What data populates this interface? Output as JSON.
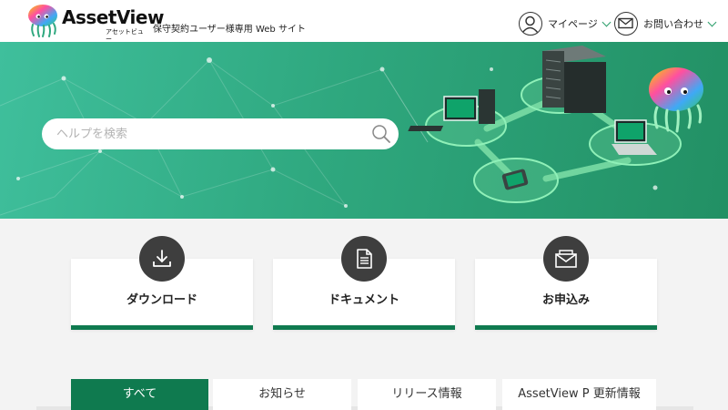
{
  "header": {
    "logo_text": "AssetView",
    "logo_sub": "アセットビュー",
    "site_caption": "保守契約ユーザー様専用 Web サイト",
    "mypage_label": "マイページ",
    "contact_label": "お問い合わせ"
  },
  "hero": {
    "search_placeholder": "ヘルプを検索"
  },
  "cards": [
    {
      "label": "ダウンロード",
      "icon": "download-icon"
    },
    {
      "label": "ドキュメント",
      "icon": "document-icon"
    },
    {
      "label": "お申込み",
      "icon": "envelope-icon"
    }
  ],
  "tabs": [
    {
      "label": "すべて",
      "active": true
    },
    {
      "label": "お知らせ",
      "active": false
    },
    {
      "label": "リリース情報",
      "active": false
    },
    {
      "label": "AssetView P 更新情報",
      "active": false
    }
  ],
  "colors": {
    "brand_green": "#0f7a4f",
    "hero_start": "#3fbf9c",
    "hero_end": "#229064",
    "icon_circle": "#3e3e3e"
  }
}
